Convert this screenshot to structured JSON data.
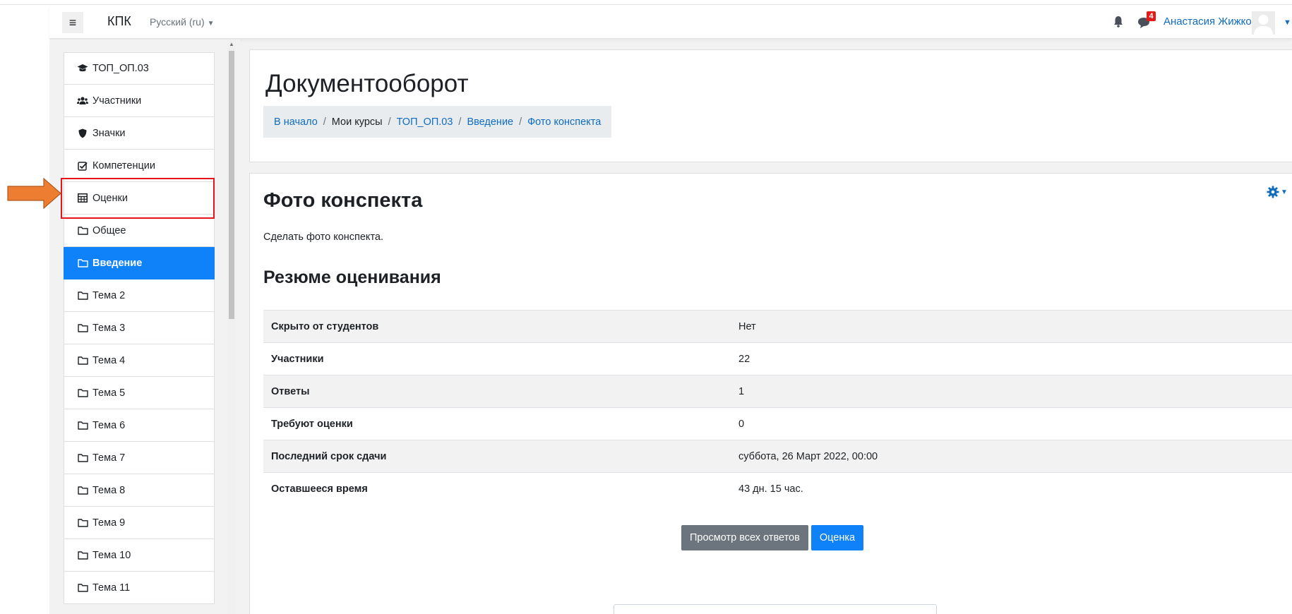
{
  "navbar": {
    "brand": "КПК",
    "language": "Русский (ru)",
    "notification_count": "4",
    "user_name": "Анастасия Жижко"
  },
  "drawer": {
    "items": [
      {
        "label": "ТОП_ОП.03",
        "icon": "graduation-cap-icon"
      },
      {
        "label": "Участники",
        "icon": "users-icon"
      },
      {
        "label": "Значки",
        "icon": "shield-icon"
      },
      {
        "label": "Компетенции",
        "icon": "check-square-icon"
      },
      {
        "label": "Оценки",
        "icon": "table-icon"
      },
      {
        "label": "Общее",
        "icon": "folder-icon"
      },
      {
        "label": "Введение",
        "icon": "folder-icon",
        "active": true
      },
      {
        "label": "Тема 2",
        "icon": "folder-icon"
      },
      {
        "label": "Тема 3",
        "icon": "folder-icon"
      },
      {
        "label": "Тема 4",
        "icon": "folder-icon"
      },
      {
        "label": "Тема 5",
        "icon": "folder-icon"
      },
      {
        "label": "Тема 6",
        "icon": "folder-icon"
      },
      {
        "label": "Тема 7",
        "icon": "folder-icon"
      },
      {
        "label": "Тема 8",
        "icon": "folder-icon"
      },
      {
        "label": "Тема 9",
        "icon": "folder-icon"
      },
      {
        "label": "Тема 10",
        "icon": "folder-icon"
      },
      {
        "label": "Тема 11",
        "icon": "folder-icon"
      }
    ]
  },
  "header": {
    "title": "Документооборот",
    "breadcrumb": [
      {
        "label": "В начало",
        "link": true
      },
      {
        "label": "Мои курсы",
        "link": false
      },
      {
        "label": "ТОП_ОП.03",
        "link": true
      },
      {
        "label": "Введение",
        "link": true
      },
      {
        "label": "Фото конспекта",
        "link": true
      }
    ]
  },
  "activity": {
    "title": "Фото конспекта",
    "description": "Сделать фото конспекта.",
    "summary_title": "Резюме оценивания",
    "summary": [
      {
        "key": "Скрыто от студентов",
        "value": "Нет"
      },
      {
        "key": "Участники",
        "value": "22"
      },
      {
        "key": "Ответы",
        "value": "1"
      },
      {
        "key": "Требуют оценки",
        "value": "0"
      },
      {
        "key": "Последний срок сдачи",
        "value": "суббота, 26 Март 2022, 00:00"
      },
      {
        "key": "Оставшееся время",
        "value": "43 дн. 15 час."
      }
    ],
    "view_all_button": "Просмотр всех ответов",
    "grade_button": "Оценка"
  },
  "colors": {
    "accent": "#0f82fa",
    "link": "#0f6cbf",
    "highlight": "#e8141b",
    "arrow": "#ed7d31",
    "badge": "#e21a1a"
  }
}
